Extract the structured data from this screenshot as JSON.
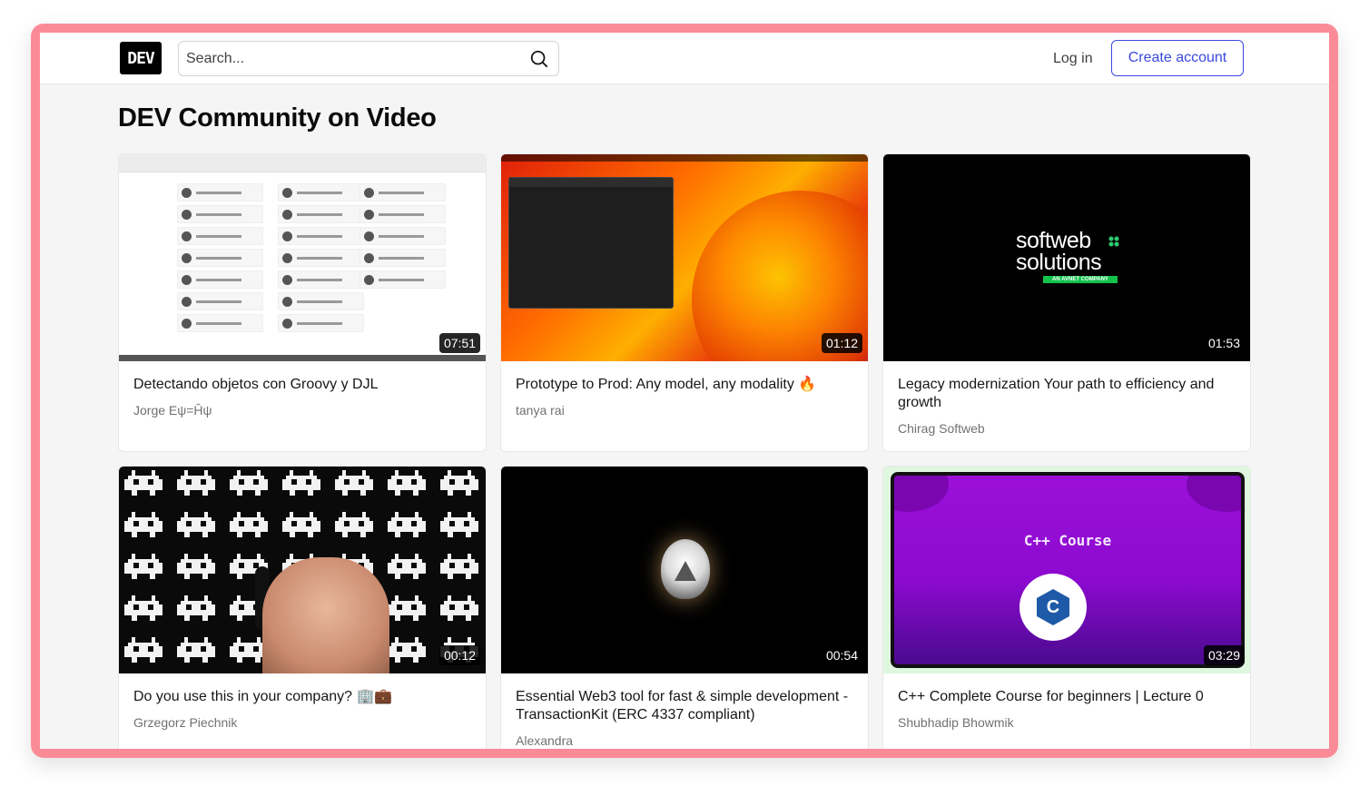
{
  "header": {
    "logo_text": "DEV",
    "search_placeholder": "Search...",
    "login_label": "Log in",
    "create_account_label": "Create account"
  },
  "page": {
    "title": "DEV Community on Video"
  },
  "videos": [
    {
      "title": "Detectando objetos con Groovy y DJL",
      "author": "Jorge Eψ=Ĥψ",
      "duration": "07:51"
    },
    {
      "title": "Prototype to Prod: Any model, any modality 🔥",
      "author": "tanya rai",
      "duration": "01:12"
    },
    {
      "title": "Legacy modernization Your path to efficiency and growth",
      "author": "Chirag Softweb",
      "duration": "01:53",
      "thumb_text": "softweb solutions",
      "thumb_tag": "AN AVNET COMPANY"
    },
    {
      "title": "Do you use this in your company? 🏢💼",
      "author": "Grzegorz Piechnik",
      "duration": "00:12"
    },
    {
      "title": "Essential Web3 tool for fast & simple development - TransactionKit (ERC 4337 compliant)",
      "author": "Alexandra",
      "duration": "00:54"
    },
    {
      "title": "C++ Complete Course for beginners | Lecture 0",
      "author": "Shubhadip Bhowmik",
      "duration": "03:29",
      "thumb_text": "C++ Course",
      "thumb_logo": "C"
    }
  ],
  "colors": {
    "accent": "#3b49df",
    "frame": "#fb8c97",
    "background": "#f5f5f5"
  }
}
